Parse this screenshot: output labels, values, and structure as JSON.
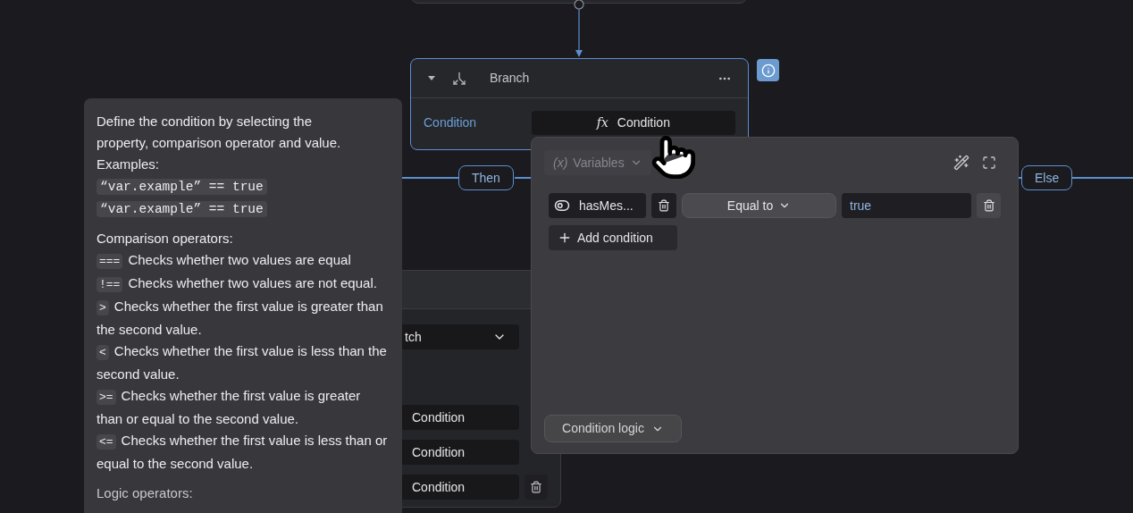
{
  "branch_node": {
    "title": "Branch",
    "condition_label": "Condition",
    "condition_button": "Condition",
    "fx_symbol": "fx"
  },
  "edges": [
    {
      "label": "Then"
    },
    {
      "label": "Else"
    }
  ],
  "back_node": {
    "dropdown": "tch",
    "conditions": [
      "Condition",
      "Condition",
      "Condition"
    ]
  },
  "tooltip": {
    "intro": "Define the condition by selecting the property, comparison operator and value.",
    "examples_label": "Examples:",
    "examples": [
      "“var.example” == true",
      "“var.example” == true"
    ],
    "comparison_heading": "Comparison operators:",
    "operators": [
      {
        "code": "===",
        "text": "Checks whether two values are equal"
      },
      {
        "code": "!==",
        "text": "Checks whether two values are not equal."
      },
      {
        "code": ">",
        "text": "Checks whether the first value is greater than the second value."
      },
      {
        "code": "<",
        "text": "Checks whether the first value is less than the second value."
      },
      {
        "code": ">=",
        "text": "Checks whether the first value is greater than or equal to the second value."
      },
      {
        "code": "<=",
        "text": "Checks whether the first value is less than or equal to the second value."
      }
    ],
    "logic_heading": "Logic operators:"
  },
  "popup": {
    "variables": {
      "symbol": "(x)",
      "label": "Variables",
      "disabled": true
    },
    "conditions": [
      {
        "property": "hasMes...",
        "operator": "Equal to",
        "value": "true"
      }
    ],
    "add_condition": "Add condition",
    "condition_logic": "Condition logic"
  }
}
